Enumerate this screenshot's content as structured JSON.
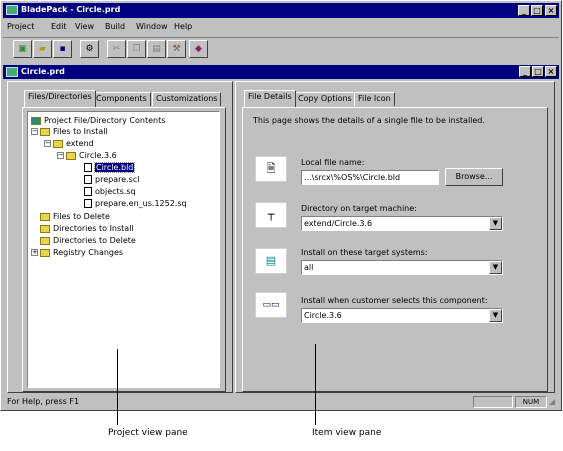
{
  "app": {
    "title": "BladePack - Circle.prd"
  },
  "menu": [
    "Project",
    "Edit",
    "View",
    "Build",
    "Window",
    "Help"
  ],
  "toolbar": {
    "icons": [
      "new-icon",
      "open-icon",
      "save-icon",
      "project-settings-icon",
      "cut-icon",
      "copy-icon",
      "paste-icon",
      "build-icon",
      "help-book-icon"
    ]
  },
  "child_window": {
    "title": "Circle.prd"
  },
  "left_tabs": [
    "Files/Directories",
    "Components",
    "Customizations"
  ],
  "tree": {
    "root": "Project File/Directory Contents",
    "files_to_install": "Files to Install",
    "extend": "extend",
    "circle_folder": "Circle.3.6",
    "files": [
      "Circle.bld",
      "prepare.scl",
      "objects.sq",
      "prepare.en_us.1252.sq"
    ],
    "files_to_delete": "Files to Delete",
    "dirs_to_install": "Directories to Install",
    "dirs_to_delete": "Directories to Delete",
    "registry_changes": "Registry Changes"
  },
  "right_tabs": [
    "File Details",
    "Copy Options",
    "File Icon"
  ],
  "details": {
    "description": "This page shows the details of a single file to be installed.",
    "local_label": "Local file name:",
    "local_value": "...\\srcx\\%OS%\\Circle.bld",
    "browse": "Browse...",
    "dir_label": "Directory on target machine:",
    "dir_value": "extend/Circle.3.6",
    "systems_label": "Install on these target systems:",
    "systems_value": "all",
    "component_label": "Install when customer selects this component:",
    "component_value": "Circle.3.6"
  },
  "status": {
    "help": "For Help, press F1",
    "num": "NUM"
  },
  "callouts": {
    "project": "Project view pane",
    "item": "Item view pane"
  },
  "colors": {
    "titlebar": "#000080",
    "face": "#c0c0c0",
    "selection": "#000080"
  }
}
